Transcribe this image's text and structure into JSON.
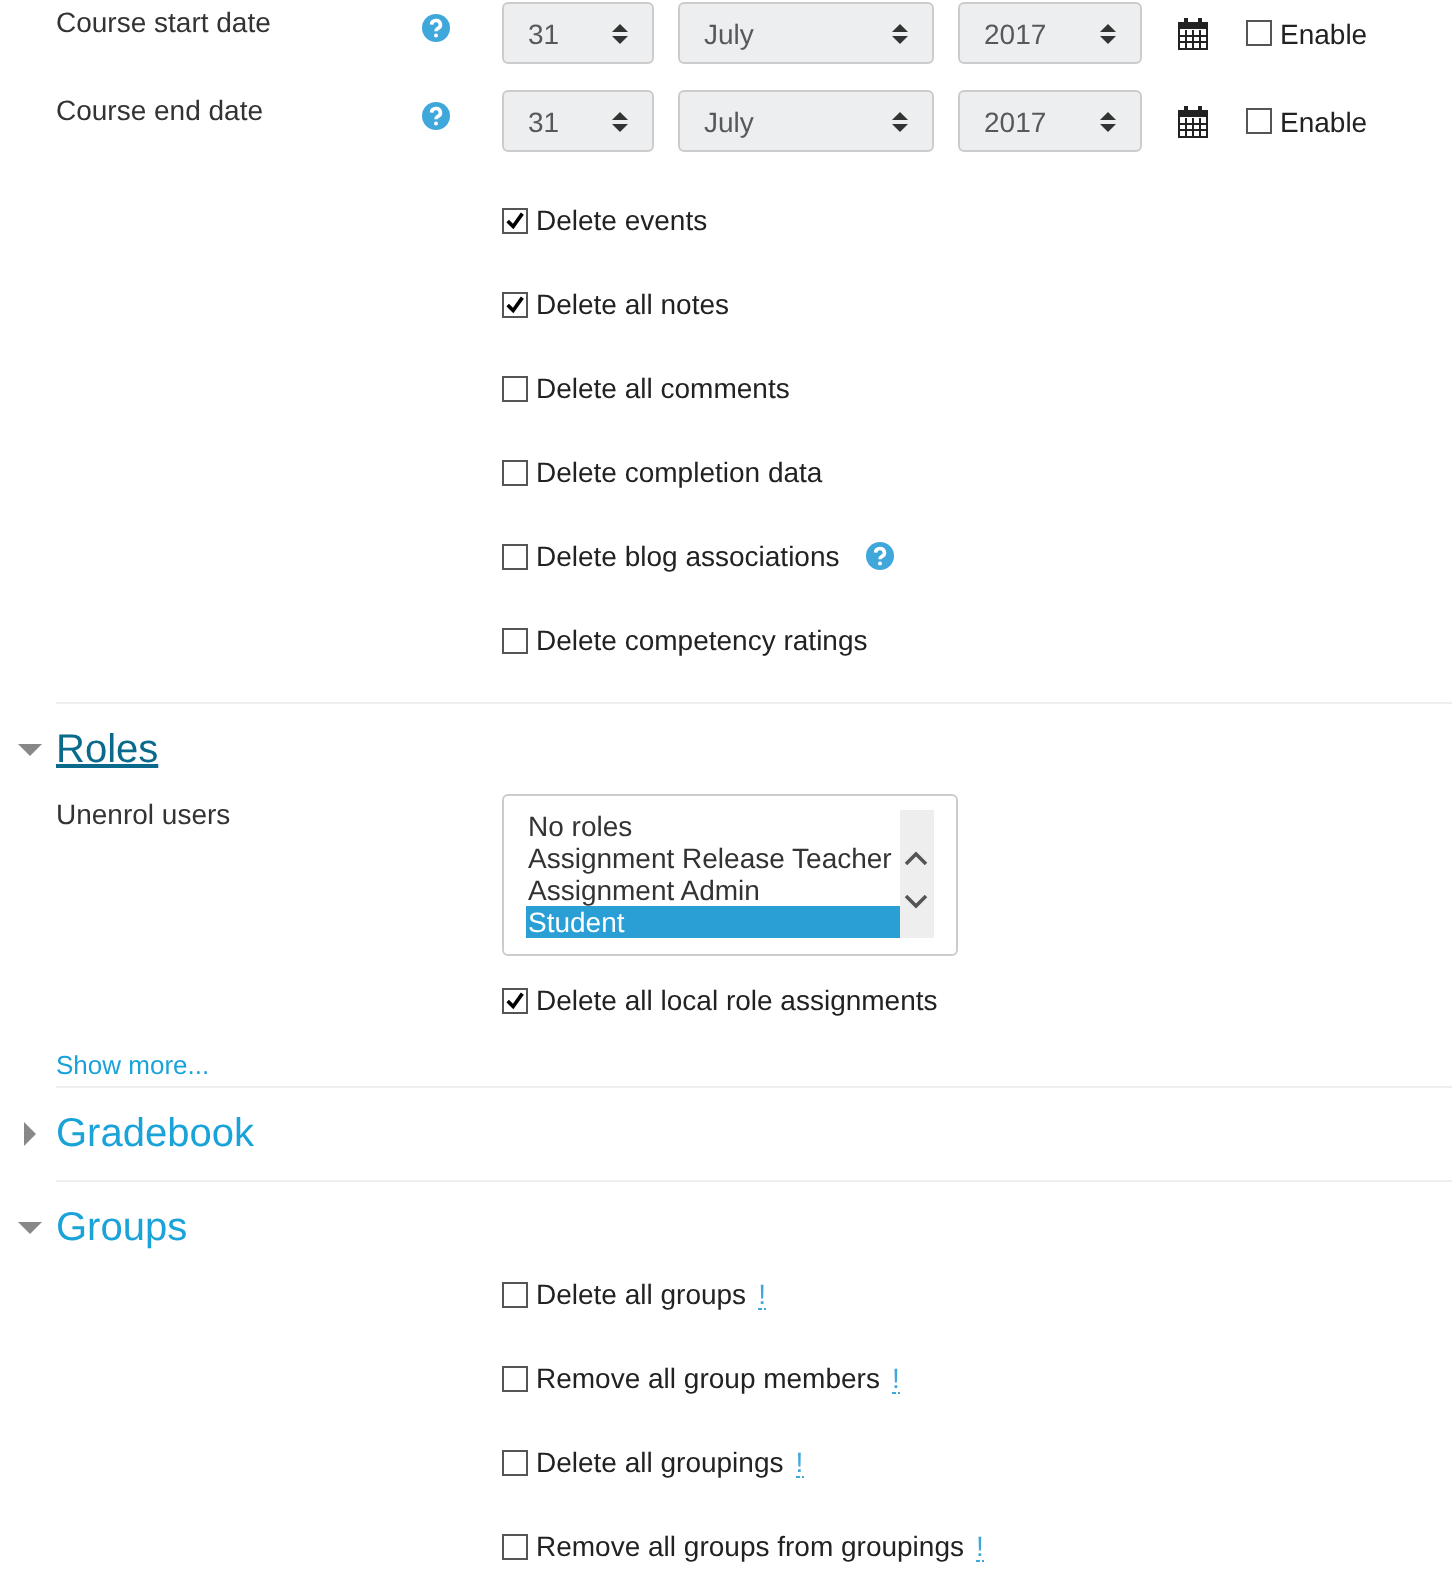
{
  "dates": [
    {
      "label": "Course start date",
      "day": "31",
      "month": "July",
      "year": "2017",
      "enable_label": "Enable",
      "enabled": false
    },
    {
      "label": "Course end date",
      "day": "31",
      "month": "July",
      "year": "2017",
      "enable_label": "Enable",
      "enabled": false
    }
  ],
  "options": [
    {
      "label": "Delete events",
      "checked": true,
      "help": false
    },
    {
      "label": "Delete all notes",
      "checked": true,
      "help": false
    },
    {
      "label": "Delete all comments",
      "checked": false,
      "help": false
    },
    {
      "label": "Delete completion data",
      "checked": false,
      "help": false
    },
    {
      "label": "Delete blog associations",
      "checked": false,
      "help": true
    },
    {
      "label": "Delete competency ratings",
      "checked": false,
      "help": false
    }
  ],
  "sections": [
    {
      "title": "Roles",
      "expanded": true,
      "focused": true,
      "listbox": {
        "label": "Unenrol users",
        "items": [
          {
            "text": "No roles",
            "selected": false
          },
          {
            "text": "Assignment Release Teacher",
            "selected": false
          },
          {
            "text": "Assignment Admin",
            "selected": false
          },
          {
            "text": "Student",
            "selected": true
          }
        ]
      },
      "options": [
        {
          "label": "Delete all local role assignments",
          "checked": true
        }
      ],
      "show_more": "Show more..."
    },
    {
      "title": "Gradebook",
      "expanded": false,
      "focused": false
    },
    {
      "title": "Groups",
      "expanded": true,
      "focused": false,
      "options": [
        {
          "label": "Delete all groups",
          "checked": false,
          "mark": "!"
        },
        {
          "label": "Remove all group members",
          "checked": false,
          "mark": "!"
        },
        {
          "label": "Delete all groupings",
          "checked": false,
          "mark": "!"
        },
        {
          "label": "Remove all groups from groupings",
          "checked": false,
          "mark": "!"
        }
      ]
    }
  ]
}
